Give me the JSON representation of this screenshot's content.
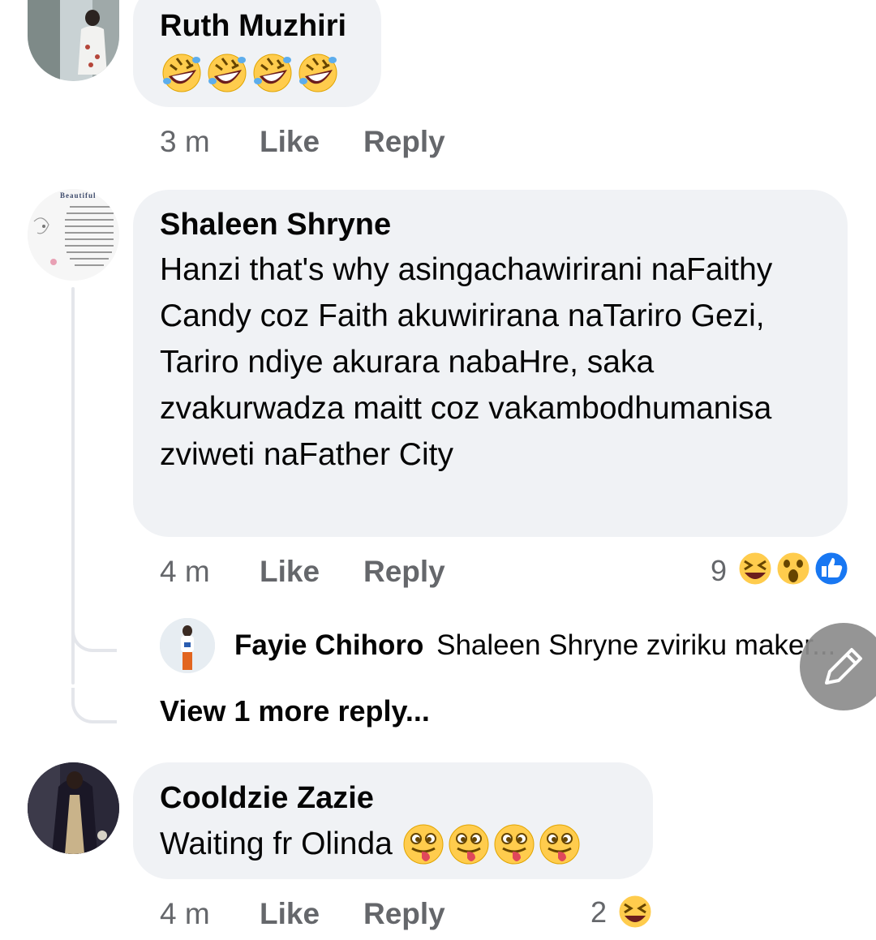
{
  "comments": [
    {
      "author": "Ruth Muzhiri",
      "emoji_text": "🤣🤣🤣🤣",
      "time": "3 m",
      "like_label": "Like",
      "reply_label": "Reply"
    },
    {
      "author": "Shaleen Shryne",
      "text": "Hanzi that's why asingachawirirani naFaithy Candy coz Faith akuwirirana naTariro Gezi, Tariro ndiye akurara nabaHre, saka zvakurwadza maitt coz vakambodhumanisa zviweti naFather City",
      "time": "4 m",
      "like_label": "Like",
      "reply_label": "Reply",
      "reaction_count": "9",
      "reaction_icons": [
        "laughing-emoji",
        "wow-emoji",
        "like-thumb"
      ],
      "replies": {
        "preview_author": "Fayie Chihoro",
        "preview_text": "Shaleen Shryne zviriku maker...",
        "view_more_label": "View 1 more reply..."
      }
    },
    {
      "author": "Cooldzie Zazie",
      "text": "Waiting fr Olinda",
      "emoji_text": "😜😜😜😜",
      "time": "4 m",
      "like_label": "Like",
      "reply_label": "Reply",
      "reaction_count": "2",
      "reaction_icons": [
        "laughing-emoji"
      ]
    }
  ],
  "avatar_text": [
    "Beautiful"
  ],
  "fab": {
    "icon": "pencil-icon"
  },
  "colors": {
    "bubble": "#f0f2f5",
    "meta": "#65676b",
    "like_blue": "#1877f2",
    "emoji_yellow": "#ffcc4d"
  }
}
